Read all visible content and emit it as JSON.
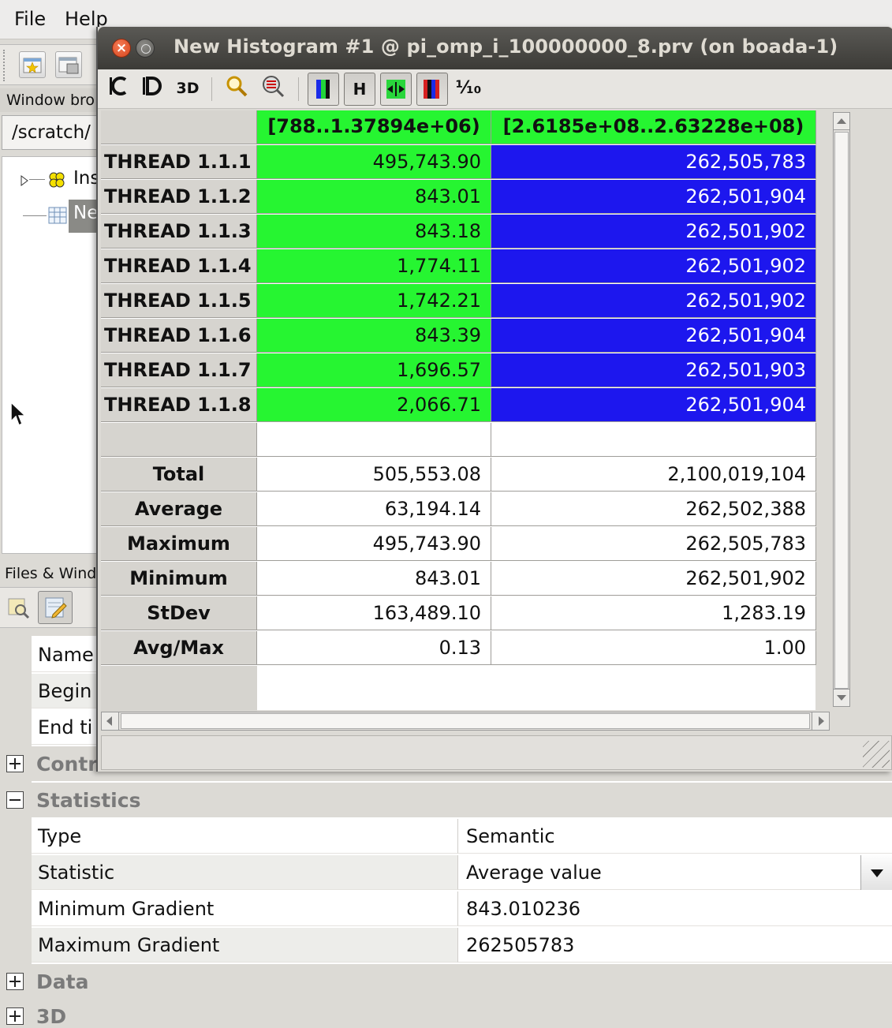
{
  "menu": {
    "file": "File",
    "help": "Help"
  },
  "main": {
    "window_browser_label": "Window bro",
    "path": "/scratch/",
    "tree": [
      {
        "label": "Ins"
      },
      {
        "label": "Ne"
      }
    ],
    "files_label": "Files & Wind"
  },
  "histogram": {
    "title": "New Histogram #1 @ pi_omp_i_100000000_8.prv (on boada-1)",
    "toolbar": {
      "btn_3d": "3D",
      "btn_h": "H",
      "btn_percent": "⅒"
    },
    "columns": [
      "[788..1.37894e+06)",
      "[2.6185e+08..2.63228e+08)"
    ],
    "rows": [
      {
        "label": "THREAD 1.1.1",
        "values": [
          "495,743.90",
          "262,505,783"
        ]
      },
      {
        "label": "THREAD 1.1.2",
        "values": [
          "843.01",
          "262,501,904"
        ]
      },
      {
        "label": "THREAD 1.1.3",
        "values": [
          "843.18",
          "262,501,902"
        ]
      },
      {
        "label": "THREAD 1.1.4",
        "values": [
          "1,774.11",
          "262,501,902"
        ]
      },
      {
        "label": "THREAD 1.1.5",
        "values": [
          "1,742.21",
          "262,501,902"
        ]
      },
      {
        "label": "THREAD 1.1.6",
        "values": [
          "843.39",
          "262,501,904"
        ]
      },
      {
        "label": "THREAD 1.1.7",
        "values": [
          "1,696.57",
          "262,501,903"
        ]
      },
      {
        "label": "THREAD 1.1.8",
        "values": [
          "2,066.71",
          "262,501,904"
        ]
      }
    ],
    "stats": [
      {
        "label": "Total",
        "values": [
          "505,553.08",
          "2,100,019,104"
        ]
      },
      {
        "label": "Average",
        "values": [
          "63,194.14",
          "262,502,388"
        ]
      },
      {
        "label": "Maximum",
        "values": [
          "495,743.90",
          "262,505,783"
        ]
      },
      {
        "label": "Minimum",
        "values": [
          "843.01",
          "262,501,902"
        ]
      },
      {
        "label": "StDev",
        "values": [
          "163,489.10",
          "1,283.19"
        ]
      },
      {
        "label": "Avg/Max",
        "values": [
          "0.13",
          "1.00"
        ]
      }
    ],
    "colors": {
      "green": "#26f531",
      "blue": "#1d17ee"
    }
  },
  "properties": {
    "partial_rows": [
      "Name",
      "Begin",
      "End ti"
    ],
    "control_category": "Contr",
    "statistics_category": "Statistics",
    "statistics_rows": [
      {
        "key": "Type",
        "value": "Semantic"
      },
      {
        "key": "Statistic",
        "value": "Average value"
      },
      {
        "key": "Minimum Gradient",
        "value": "843.010236"
      },
      {
        "key": "Maximum Gradient",
        "value": "262505783"
      }
    ],
    "data_category": "Data",
    "threed_category": "3D"
  },
  "icons": [
    "open-icon",
    "save-config-icon",
    "find-icon",
    "edit-icon",
    "close-icon",
    "minimize-icon",
    "code-color-icon",
    "gradient-icon",
    "3d-icon",
    "zoom-icon",
    "filter-icon",
    "color-mode-icon",
    "horizontal-icon",
    "hide-columns-icon",
    "gradient-scale-icon",
    "fraction-icon",
    "cursor-icon",
    "resize-grip-icon"
  ]
}
